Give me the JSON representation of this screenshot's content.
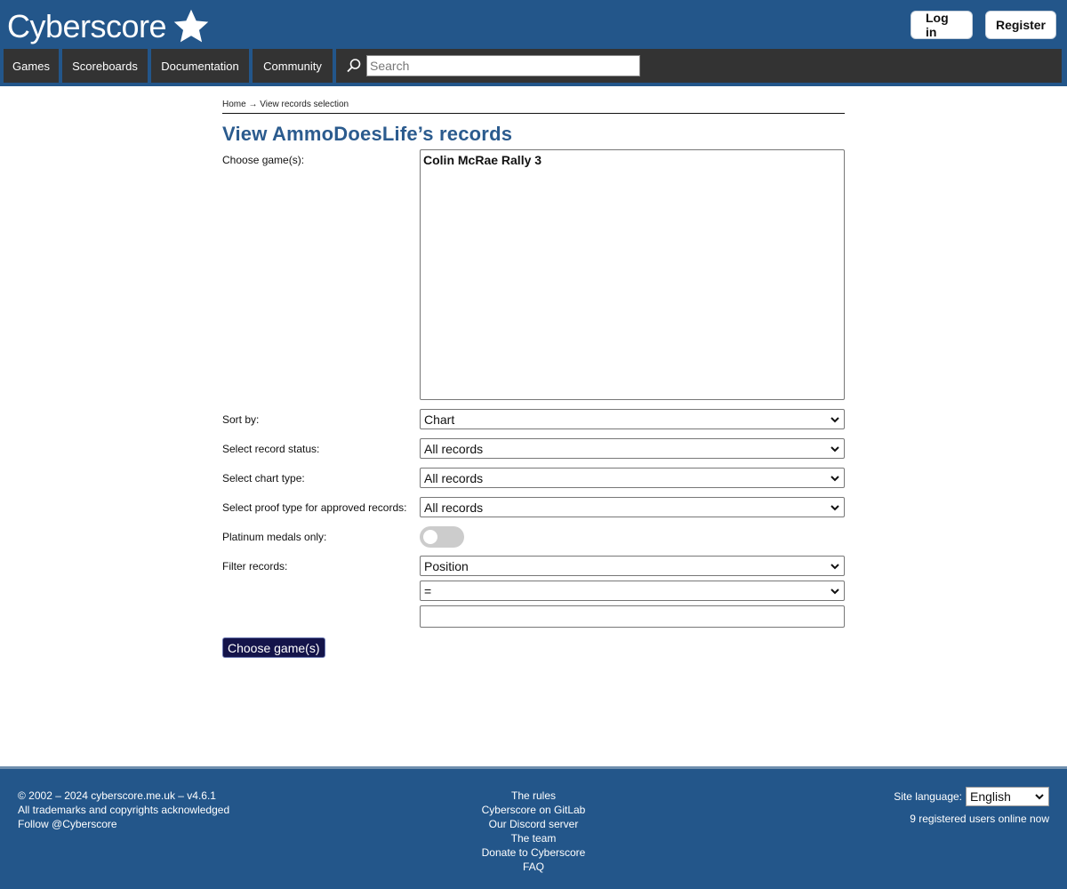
{
  "header": {
    "logo_text": "Cyberscore",
    "login_label": "Log in",
    "register_label": "Register"
  },
  "nav": {
    "items": [
      "Games",
      "Scoreboards",
      "Documentation",
      "Community"
    ],
    "search_placeholder": "Search"
  },
  "breadcrumb": {
    "home": "Home",
    "separator": "→",
    "current": "View records selection"
  },
  "page": {
    "title": "View AmmoDoesLife’s records"
  },
  "form": {
    "choose_games_label": "Choose game(s):",
    "games": [
      "Colin McRae Rally 3"
    ],
    "sort_by_label": "Sort by:",
    "sort_by_value": "Chart",
    "record_status_label": "Select record status:",
    "record_status_value": "All records",
    "chart_type_label": "Select chart type:",
    "chart_type_value": "All records",
    "proof_type_label": "Select proof type for approved records:",
    "proof_type_value": "All records",
    "platinum_label": "Platinum medals only:",
    "platinum_enabled": false,
    "filter_label": "Filter records:",
    "filter_field_value": "Position",
    "filter_operator_value": "=",
    "filter_value": "",
    "submit_label": "Choose game(s)"
  },
  "footer": {
    "copyright": "© 2002 – 2024 cyberscore.me.uk – v4.6.1",
    "trademarks": "All trademarks and copyrights acknowledged",
    "follow": "Follow @Cyberscore",
    "links": [
      "The rules",
      "Cyberscore on GitLab",
      "Our Discord server",
      "The team",
      "Donate to Cyberscore",
      "FAQ"
    ],
    "site_language_label": "Site language:",
    "site_language_value": "English",
    "online_text": "9 registered users online now"
  },
  "colors": {
    "brand_blue": "#23568a",
    "nav_dark": "#333333",
    "title_blue": "#2b5b8e",
    "submit_navy": "#14144a"
  },
  "icons": [
    "star-icon",
    "search-icon",
    "chevron-down-icon"
  ]
}
